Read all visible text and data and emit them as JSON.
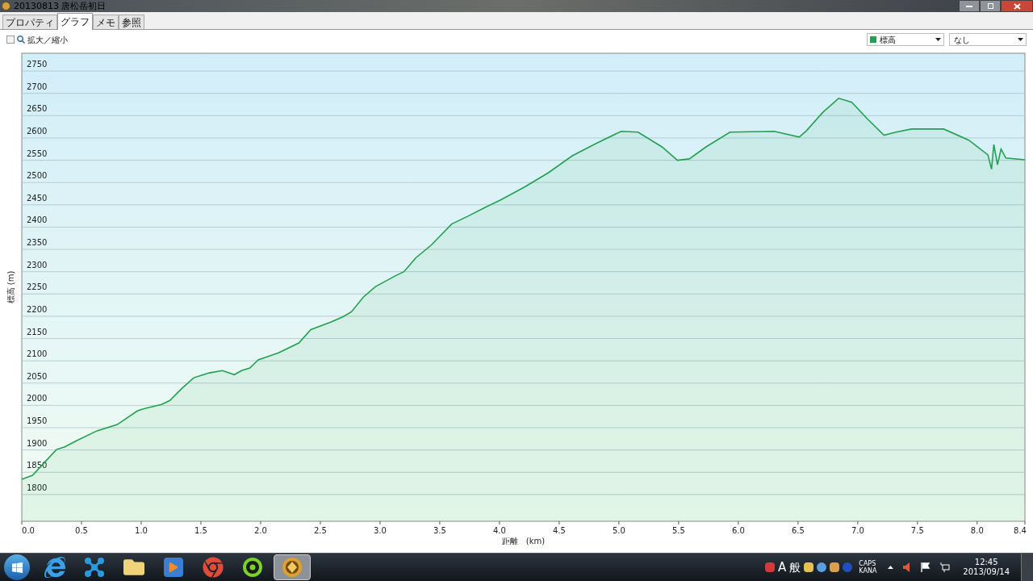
{
  "window": {
    "title": "20130813 唐松岳初日"
  },
  "tabs": [
    {
      "label": "プロパティ",
      "selected": false
    },
    {
      "label": "グラフ",
      "selected": true
    },
    {
      "label": "メモ",
      "selected": false
    },
    {
      "label": "参照",
      "selected": false
    }
  ],
  "toolbar": {
    "zoom": {
      "label": "拡大／縮小",
      "checked": false
    },
    "second_select": {
      "value": "なし"
    }
  },
  "chart_data": {
    "type": "area",
    "grid": true,
    "xlabel": "距離　(km)",
    "ylabel": "標高 (m)",
    "xlim": [
      0,
      8.4
    ],
    "ylim": [
      1740,
      2790
    ],
    "xticks": [
      {
        "value": 0,
        "label": "0.0"
      },
      {
        "value": 0.5,
        "label": "0.5"
      },
      {
        "value": 1,
        "label": "1.0"
      },
      {
        "value": 1.5,
        "label": "1.5"
      },
      {
        "value": 2,
        "label": "2.0"
      },
      {
        "value": 2.5,
        "label": "2.5"
      },
      {
        "value": 3,
        "label": "3.0"
      },
      {
        "value": 3.5,
        "label": "3.5"
      },
      {
        "value": 4,
        "label": "4.0"
      },
      {
        "value": 4.5,
        "label": "4.5"
      },
      {
        "value": 5,
        "label": "5.0"
      },
      {
        "value": 5.5,
        "label": "5.5"
      },
      {
        "value": 6,
        "label": "6.0"
      },
      {
        "value": 6.5,
        "label": "6.5"
      },
      {
        "value": 7,
        "label": "7.0"
      },
      {
        "value": 7.5,
        "label": "7.5"
      },
      {
        "value": 8,
        "label": "8.0"
      },
      {
        "value": 8.4,
        "label": "8.4"
      }
    ],
    "yticks": [
      1800,
      1850,
      1900,
      1950,
      2000,
      2050,
      2100,
      2150,
      2200,
      2250,
      2300,
      2350,
      2400,
      2450,
      2500,
      2550,
      2600,
      2650,
      2700,
      2750
    ],
    "x": [
      0,
      0.09,
      0.19,
      0.29,
      0.36,
      0.46,
      0.63,
      0.8,
      0.97,
      1.03,
      1.17,
      1.24,
      1.34,
      1.44,
      1.57,
      1.68,
      1.78,
      1.84,
      1.91,
      1.98,
      2.15,
      2.32,
      2.42,
      2.59,
      2.69,
      2.76,
      2.86,
      2.96,
      3.13,
      3.2,
      3.3,
      3.43,
      3.6,
      3.74,
      3.87,
      4.01,
      4.21,
      4.41,
      4.61,
      4.82,
      5.02,
      5.16,
      5.36,
      5.49,
      5.59,
      5.73,
      5.93,
      6.3,
      6.51,
      6.57,
      6.71,
      6.84,
      6.95,
      7.08,
      7.22,
      7.32,
      7.45,
      7.72,
      7.93,
      8.09,
      8.12,
      8.14,
      8.17,
      8.2,
      8.24,
      8.4
    ],
    "series": [
      {
        "name": "標高",
        "color": "#22a050",
        "values": [
          1834,
          1843,
          1872,
          1901,
          1907,
          1921,
          1943,
          1957,
          1988,
          1993,
          2002,
          2011,
          2038,
          2062,
          2073,
          2078,
          2069,
          2078,
          2084,
          2102,
          2118,
          2140,
          2170,
          2187,
          2199,
          2210,
          2243,
          2266,
          2291,
          2300,
          2331,
          2360,
          2407,
          2425,
          2443,
          2461,
          2490,
          2522,
          2560,
          2589,
          2615,
          2613,
          2580,
          2550,
          2553,
          2580,
          2613,
          2615,
          2602,
          2616,
          2658,
          2689,
          2680,
          2643,
          2606,
          2613,
          2620,
          2620,
          2595,
          2562,
          2530,
          2585,
          2540,
          2575,
          2555,
          2551
        ]
      }
    ]
  },
  "taskbar": {
    "apps": [
      {
        "kind": "browser",
        "selected": false
      },
      {
        "kind": "network",
        "selected": false
      },
      {
        "kind": "folder",
        "selected": false
      },
      {
        "kind": "player",
        "selected": false
      },
      {
        "kind": "chrome",
        "selected": false
      },
      {
        "kind": "gear",
        "selected": false
      },
      {
        "kind": "compass",
        "selected": true
      }
    ],
    "tray": {
      "ime_mode": "A",
      "ime_input": "般",
      "caps": "CAPS",
      "kana": "KANA",
      "time": "12:45",
      "date": "2013/09/14"
    }
  }
}
